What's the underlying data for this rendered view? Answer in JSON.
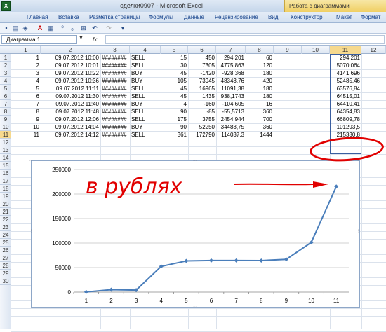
{
  "window": {
    "title": "сделки0907 - Microsoft Excel",
    "context_tab": "Работа с диаграммами"
  },
  "ribbon": {
    "tabs": [
      "Главная",
      "Вставка",
      "Разметка страницы",
      "Формулы",
      "Данные",
      "Рецензирование",
      "Вид",
      "Конструктор",
      "Макет",
      "Формат"
    ]
  },
  "namebox": {
    "value": "Диаграмма 1"
  },
  "formula_bar": {
    "fx": "fx",
    "value": ""
  },
  "columns": [
    "1",
    "2",
    "3",
    "4",
    "5",
    "6",
    "7",
    "8",
    "9",
    "10",
    "11",
    "12"
  ],
  "rows": [
    "1",
    "2",
    "3",
    "4",
    "5",
    "6",
    "7",
    "8",
    "9",
    "10",
    "11",
    "12",
    "13",
    "14",
    "15",
    "16",
    "17",
    "18",
    "19",
    "20",
    "21",
    "22",
    "23",
    "24",
    "25",
    "26",
    "27",
    "28",
    "29",
    "30"
  ],
  "table": [
    [
      "1",
      "09.07.2012 10:00",
      "########",
      "SELL",
      "15",
      "450",
      "294,201",
      "60",
      "",
      "",
      "294,201"
    ],
    [
      "2",
      "09.07.2012 10:01",
      "########",
      "SELL",
      "30",
      "7305",
      "4775,863",
      "120",
      "",
      "",
      "5070,064"
    ],
    [
      "3",
      "09.07.2012 10:22",
      "########",
      "BUY",
      "45",
      "-1420",
      "-928,368",
      "180",
      "",
      "",
      "4141,696"
    ],
    [
      "4",
      "09.07.2012 10:36",
      "########",
      "BUY",
      "105",
      "73945",
      "48343,76",
      "420",
      "",
      "",
      "52485,46"
    ],
    [
      "5",
      "09.07.2012 11:11",
      "########",
      "SELL",
      "45",
      "16965",
      "11091,38",
      "180",
      "",
      "",
      "63576,84"
    ],
    [
      "6",
      "09.07.2012 11:30",
      "########",
      "SELL",
      "45",
      "1435",
      "938,1743",
      "180",
      "",
      "",
      "64515,01"
    ],
    [
      "7",
      "09.07.2012 11:40",
      "########",
      "BUY",
      "4",
      "-160",
      "-104,605",
      "16",
      "",
      "",
      "64410,41"
    ],
    [
      "8",
      "09.07.2012 11:48",
      "########",
      "SELL",
      "90",
      "-85",
      "-55,5713",
      "360",
      "",
      "",
      "64354,83"
    ],
    [
      "9",
      "09.07.2012 12:06",
      "########",
      "SELL",
      "175",
      "3755",
      "2454,944",
      "700",
      "",
      "",
      "66809,78"
    ],
    [
      "10",
      "09.07.2012 14:04",
      "########",
      "BUY",
      "90",
      "52250",
      "34483,75",
      "360",
      "",
      "",
      "101293,5"
    ],
    [
      "11",
      "09.07.2012 14:12",
      "########",
      "SELL",
      "361",
      "172790",
      "114037,3",
      "1444",
      "",
      "",
      "215330,8"
    ]
  ],
  "annotation": {
    "text": "в рублях",
    "color": "#e10000"
  },
  "chart_data": {
    "type": "line",
    "categories": [
      "1",
      "2",
      "3",
      "4",
      "5",
      "6",
      "7",
      "8",
      "9",
      "10",
      "11"
    ],
    "series": [
      {
        "values": [
          294.201,
          5070.064,
          4141.696,
          52485.46,
          63576.84,
          64515.01,
          64410.41,
          64354.83,
          66809.78,
          101293.5,
          215330.8
        ],
        "color": "#4a7ebb"
      }
    ],
    "yticks": [
      "0",
      "50000",
      "100000",
      "150000",
      "200000",
      "250000"
    ],
    "ylim": [
      0,
      250000
    ],
    "grid": true,
    "legend": "none",
    "title": "",
    "xlabel": "",
    "ylabel": ""
  }
}
